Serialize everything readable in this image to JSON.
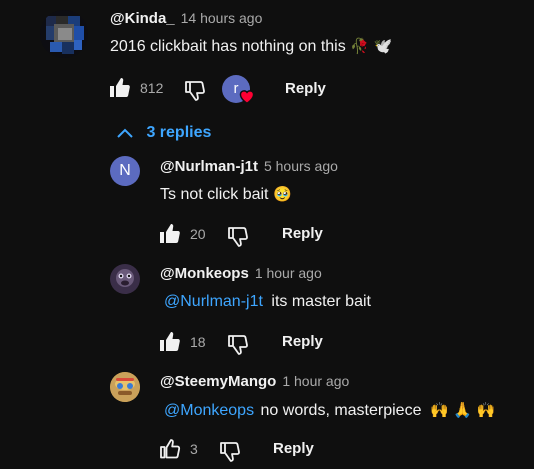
{
  "thread": {
    "top_comment": {
      "handle": "@Kinda_",
      "time": "14 hours ago",
      "text": "2016 clickbait has nothing on this",
      "emoji": "🥀 🕊️",
      "likes": "812",
      "creator_heart_avatar": "r",
      "reply_label": "Reply"
    },
    "replies_toggle": {
      "label": "3 replies"
    },
    "replies": [
      {
        "handle": "@Nurlman-j1t",
        "time": "5 hours ago",
        "avatar_letter": "N",
        "text": "Ts not click bait",
        "emoji": "🥹",
        "likes": "20",
        "reply_label": "Reply"
      },
      {
        "handle": "@Monkeops",
        "time": "1 hour ago",
        "mention": "@Nurlman-j1t",
        "text": "its master bait",
        "likes": "18",
        "reply_label": "Reply"
      },
      {
        "handle": "@SteemyMango",
        "time": "1 hour ago",
        "mention": "@Monkeops",
        "text": "no words, masterpiece",
        "emoji": "🙌 🙏 🙌",
        "likes": "3",
        "reply_label": "Reply"
      }
    ]
  },
  "colors": {
    "background": "#0f0f0f",
    "link": "#3ea6ff",
    "secondary_text": "#aaaaaa",
    "avatar_n": "#5c6bc0",
    "heart": "#ff0033"
  }
}
